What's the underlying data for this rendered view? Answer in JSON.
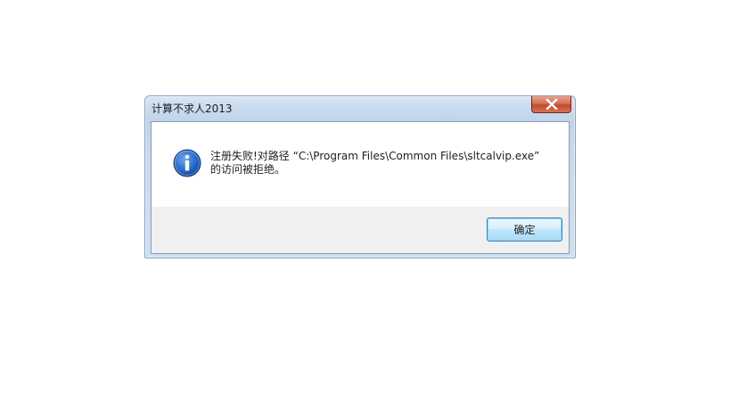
{
  "dialog": {
    "title": "计算不求人2013",
    "close_icon": "close-icon",
    "message_line1": "注册失败!对路径 “C:\\Program Files\\Common Files\\sltcalvip.exe”",
    "message_line2": "的访问被拒绝。",
    "info_icon": "information-icon",
    "ok_label": "确定"
  },
  "colors": {
    "title_bar": "#c9dbef",
    "close_button": "#c94f31",
    "button_area": "#f0f0f0",
    "ok_button_border": "#3c7fb1",
    "info_icon_blue": "#1f5fb8"
  }
}
